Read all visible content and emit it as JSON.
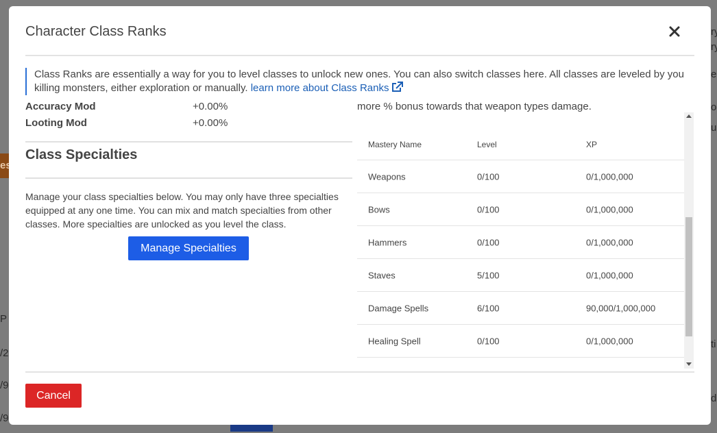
{
  "modal": {
    "title": "Character Class Ranks",
    "info_text": "Class Ranks are essentially a way for you to level classes to unlock new ones. You can also switch classes here. All classes are leveled by you killing monsters, either exploration or manually. ",
    "info_link": "learn more about Class Ranks"
  },
  "left": {
    "stats": [
      {
        "label": "Accuracy Mod",
        "value": "+0.00%"
      },
      {
        "label": "Looting Mod",
        "value": "+0.00%"
      }
    ],
    "section_title": "Class Specialties",
    "description": "Manage your class specialties below. You may only have three specialties equipped at any one time. You can mix and match specialties from other classes. More specialties are unlocked as you level the class.",
    "manage_button": "Manage Specialties"
  },
  "right": {
    "intro_text": "more % bonus towards that weapon types damage.",
    "table": {
      "headers": [
        "Mastery Name",
        "Level",
        "XP"
      ],
      "rows": [
        [
          "Weapons",
          "0/100",
          "0/1,000,000"
        ],
        [
          "Bows",
          "0/100",
          "0/1,000,000"
        ],
        [
          "Hammers",
          "0/100",
          "0/1,000,000"
        ],
        [
          "Staves",
          "5/100",
          "0/1,000,000"
        ],
        [
          "Damage Spells",
          "6/100",
          "90,000/1,000,000"
        ],
        [
          "Healing Spell",
          "0/100",
          "0/1,000,000"
        ]
      ]
    }
  },
  "footer": {
    "cancel_button": "Cancel"
  },
  "background": {
    "frag_orange": "es",
    "frag_p": "P",
    "frag_2": "/2",
    "frag_9a": "/9,",
    "frag_9b": "/9,",
    "frag_ry1": "ry",
    "frag_ry2": "ry",
    "frag_e": "e",
    "frag_o": "o",
    "frag_ur": "ur",
    "frag_ti": "ti",
    "frag_d": "d"
  },
  "colors": {
    "primary": "#1d5de6",
    "danger": "#dc2626",
    "link": "#1b5fb6",
    "info_border": "#2a6fd6"
  }
}
